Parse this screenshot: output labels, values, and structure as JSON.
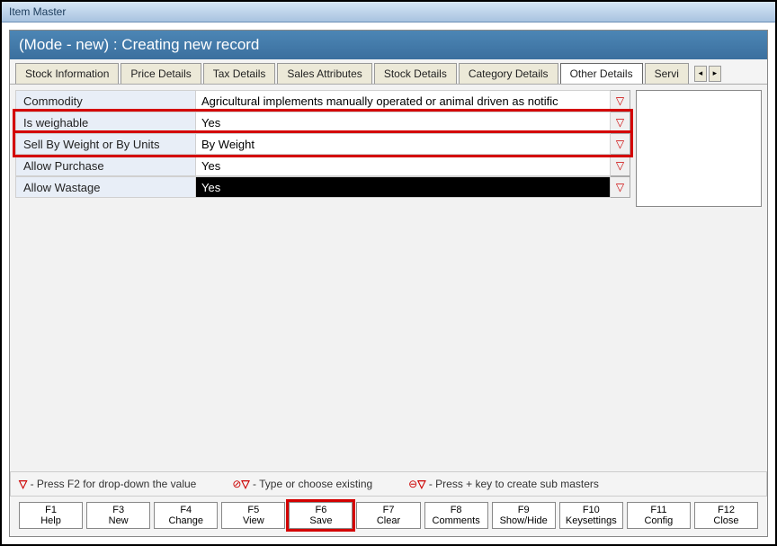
{
  "window": {
    "title": "Item Master"
  },
  "mode_bar": "(Mode - new) : Creating new record",
  "tabs": {
    "items": [
      {
        "label": "Stock Information"
      },
      {
        "label": "Price Details"
      },
      {
        "label": "Tax Details"
      },
      {
        "label": "Sales Attributes"
      },
      {
        "label": "Stock Details"
      },
      {
        "label": "Category Details"
      },
      {
        "label": "Other Details",
        "active": true
      },
      {
        "label": "Servi"
      }
    ]
  },
  "fields": {
    "commodity": {
      "label": "Commodity",
      "value": "Agricultural implements manually operated or animal driven as notific"
    },
    "is_weighable": {
      "label": "Is weighable",
      "value": "Yes"
    },
    "sell_by": {
      "label": "Sell By Weight or By Units",
      "value": "By Weight"
    },
    "allow_purchase": {
      "label": "Allow Purchase",
      "value": "Yes"
    },
    "allow_wastage": {
      "label": "Allow Wastage",
      "value": "Yes"
    }
  },
  "legend": {
    "dropdown": "- Press F2 for drop-down the value",
    "type": "- Type or choose existing",
    "sub": "- Press + key to create sub masters"
  },
  "fkeys": {
    "f1": {
      "k": "F1",
      "t": "Help"
    },
    "f3": {
      "k": "F3",
      "t": "New"
    },
    "f4": {
      "k": "F4",
      "t": "Change"
    },
    "f5": {
      "k": "F5",
      "t": "View"
    },
    "f6": {
      "k": "F6",
      "t": "Save"
    },
    "f7": {
      "k": "F7",
      "t": "Clear"
    },
    "f8": {
      "k": "F8",
      "t": "Comments"
    },
    "f9": {
      "k": "F9",
      "t": "Show/Hide"
    },
    "f10": {
      "k": "F10",
      "t": "Keysettings"
    },
    "f11": {
      "k": "F11",
      "t": "Config"
    },
    "f12": {
      "k": "F12",
      "t": "Close"
    }
  },
  "glyphs": {
    "tri": "▽",
    "left": "◂",
    "right": "▸",
    "circ_strike": "⊘",
    "ring": "⊖"
  }
}
